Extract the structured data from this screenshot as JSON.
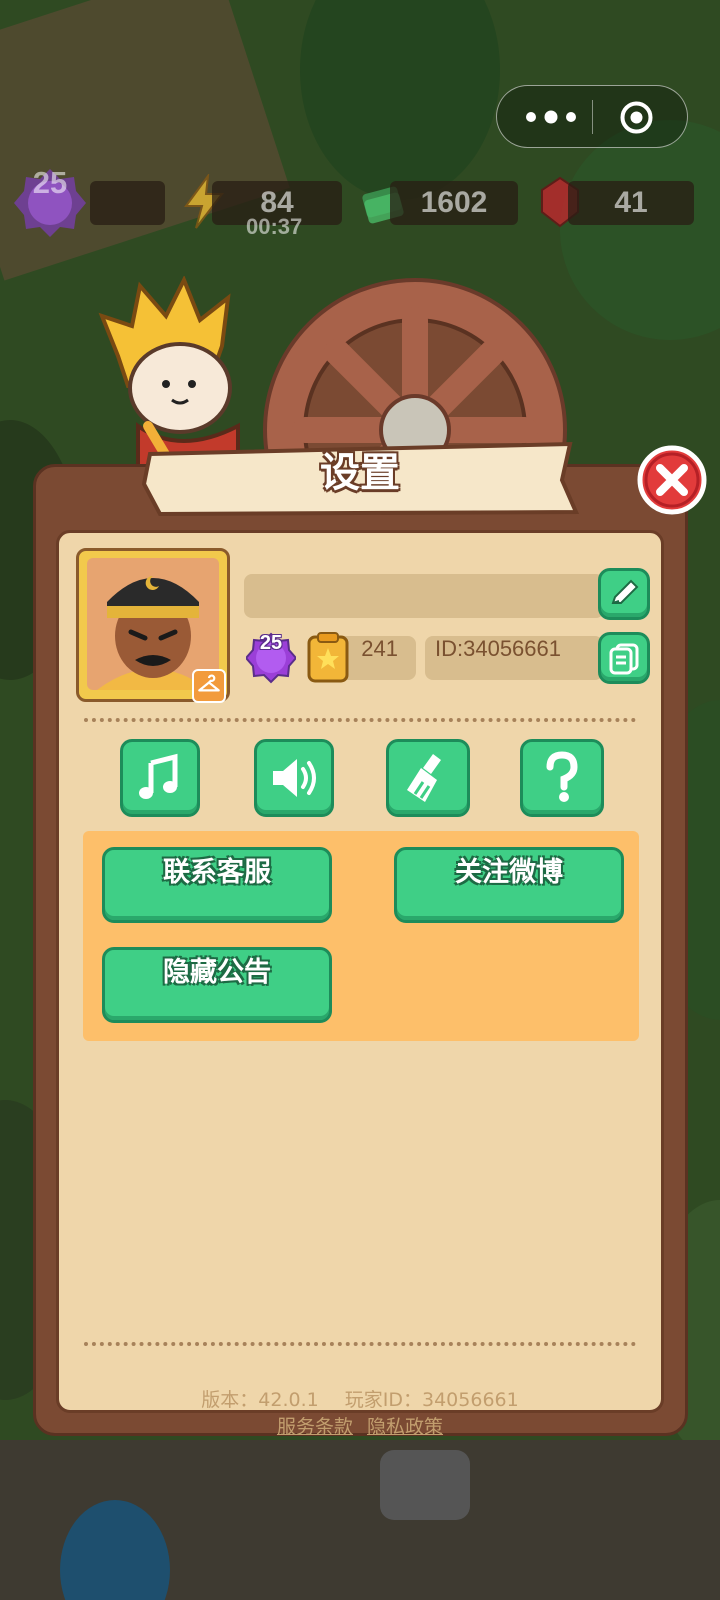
{
  "capsule": {
    "more_icon": "more-dots-icon",
    "close_icon": "target-circle-icon"
  },
  "hud": {
    "player_level": "25",
    "energy": "84",
    "energy_timer": "00:37",
    "cash": "1602",
    "gems": "41"
  },
  "dialog": {
    "title": "设置",
    "profile": {
      "name": "",
      "level": "25",
      "points": "241",
      "id_label": "ID:34056661"
    },
    "icon_buttons": [
      {
        "name": "music-toggle",
        "icon": "music-note-icon"
      },
      {
        "name": "sound-toggle",
        "icon": "speaker-icon"
      },
      {
        "name": "clear-cache",
        "icon": "broom-icon"
      },
      {
        "name": "help",
        "icon": "question-mark-icon"
      }
    ],
    "actions": {
      "contact_support": "联系客服",
      "follow_weibo": "关注微博",
      "hide_announcement": "隐藏公告"
    },
    "footer": {
      "version": "版本：42.0.1",
      "player_id": "玩家ID：34056661",
      "terms": "服务条款",
      "privacy": "隐私政策"
    }
  },
  "colors": {
    "panel": "#efd6aa",
    "frame": "#7b4a33",
    "green_button": "#3fcf86",
    "action_panel": "#fdbf6a",
    "close_red": "#e23b3b"
  }
}
